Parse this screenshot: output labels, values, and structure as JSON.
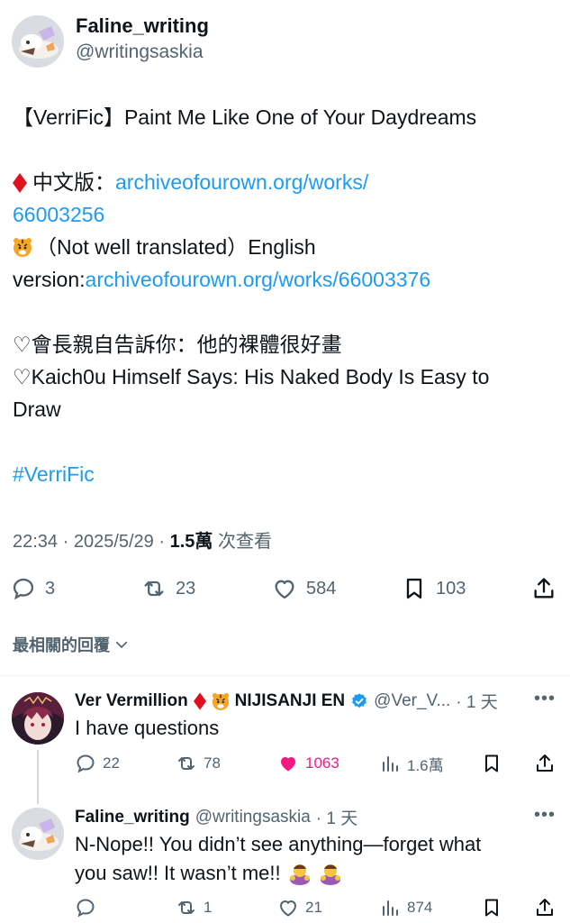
{
  "tweet": {
    "author_name": "Faline_writing",
    "author_handle": "@writingsaskia",
    "title_line": "【VerriFic】Paint Me Like One of Your Daydreams",
    "zh_label": "中文版：",
    "zh_link_1": "archiveofourown.org/works/",
    "zh_link_2": "66003256",
    "en_label_1": "（Not well translated）English",
    "en_label_2": "version:",
    "en_link": "archiveofourown.org/works/66003376",
    "zh_summary": "♡會長親自告訴你：他的裸體很好畫",
    "en_summary_1": "♡Kaich0u Himself Says: His Naked Body Is Easy to",
    "en_summary_2": "Draw",
    "hashtag": "#VerriFic",
    "time": "22:34 · 2025/5/29 · ",
    "views": "1.5萬",
    "views_label": " 次查看",
    "replies": "3",
    "reposts": "23",
    "likes": "584",
    "bookmarks": "103"
  },
  "sort_label": "最相關的回覆",
  "replies": [
    {
      "name": "Ver Vermillion",
      "org": "NIJISANJI EN",
      "handle": "@Ver_V...",
      "time": "· 1 天",
      "text": "I have questions",
      "replies": "22",
      "reposts": "78",
      "likes": "1063",
      "views": "1.6萬"
    },
    {
      "name": "Faline_writing",
      "handle": "@writingsaskia",
      "time": "· 1 天",
      "text_1": "N-Nope!! You didn’t see anything—forget what",
      "text_2": "you saw!! It wasn’t me!!",
      "replies": "",
      "reposts": "1",
      "likes": "21",
      "views": "874"
    }
  ],
  "colors": {
    "accent": "#1d9bf0",
    "text": "#0f1419",
    "muted": "#536471",
    "like": "#f91880",
    "diamond": "#e0101f"
  },
  "icons": [
    "reply-icon",
    "repost-icon",
    "like-icon",
    "bookmark-icon",
    "share-icon",
    "views-icon",
    "verified-icon",
    "chevron-down-icon",
    "more-icon"
  ]
}
